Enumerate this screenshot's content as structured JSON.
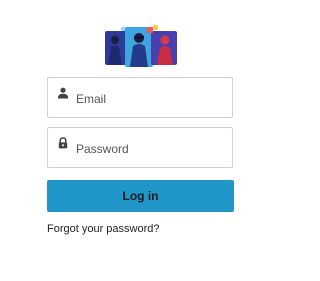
{
  "logo": {
    "icon": "people-illustration-logo"
  },
  "form": {
    "email": {
      "icon": "person-icon",
      "placeholder": "Email",
      "value": ""
    },
    "password": {
      "icon": "lock-icon",
      "placeholder": "Password",
      "value": ""
    },
    "login_label": "Log in",
    "forgot_label": "Forgot your password?"
  },
  "colors": {
    "primary": "#2196c9",
    "border": "#d0d0d0",
    "logo_blue": "#2d3a9b",
    "logo_light_blue": "#3ea5e0",
    "logo_red": "#d9374b"
  }
}
